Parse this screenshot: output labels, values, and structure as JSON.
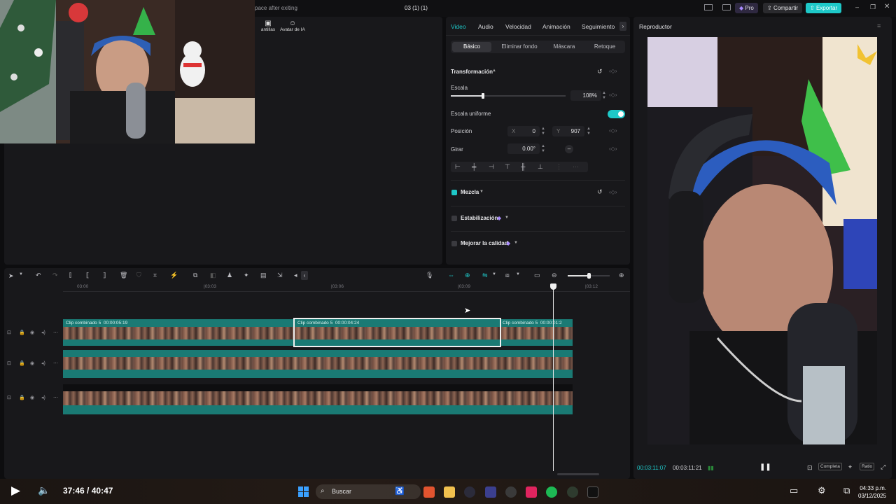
{
  "window": {
    "title_hint": "pace after exiting",
    "project_title": "03 (1) (1)",
    "pro_label": "Pro",
    "share_label": "Compartir",
    "export_label": "Exportar"
  },
  "left_panel": {
    "tools": [
      {
        "label": "antillas",
        "icon": "template-icon"
      },
      {
        "label": "Avatar de IA",
        "icon": "avatar-icon"
      }
    ]
  },
  "properties": {
    "tabs": [
      "Video",
      "Audio",
      "Velocidad",
      "Animación",
      "Seguimiento"
    ],
    "active_tab": "Video",
    "subtabs": [
      "Básico",
      "Eliminar fondo",
      "Máscara",
      "Retoque"
    ],
    "active_subtab": "Básico",
    "transform_title": "Transformación",
    "scale_label": "Escala",
    "scale_value": "108%",
    "scale_fraction": 0.28,
    "uniform_scale_label": "Escala uniforme",
    "uniform_scale_on": true,
    "position_label": "Posición",
    "pos_x_label": "X",
    "pos_x": "0",
    "pos_y_label": "Y",
    "pos_y": "907",
    "rotate_label": "Girar",
    "rotate_value": "0.00°",
    "blend_label": "Mezcla",
    "stabilization_label": "Estabilización",
    "enhance_label": "Mejorar la calidad"
  },
  "player": {
    "title": "Reproductor",
    "current_time": "00:03:11:07",
    "total_time": "00:03:11:21",
    "full_label": "Completa",
    "ratio_label": "Ratio"
  },
  "timeline": {
    "ruler": [
      "03:00",
      "|03:03",
      "|03:06",
      "|03:09",
      "|03:12"
    ],
    "clips_track1": [
      {
        "name": "Clip combinado 5",
        "duration": "00:00:05:19"
      },
      {
        "name": "Clip combinado 5",
        "duration": "00:00:04:24"
      },
      {
        "name": "Clip combinado 5",
        "duration": "00:00:01:2"
      }
    ]
  },
  "video_player": {
    "elapsed": "37:46",
    "separator": "/",
    "duration": "40:47"
  },
  "taskbar": {
    "search_placeholder": "Buscar",
    "time": "04:33 p.m.",
    "date": "03/12/2025"
  },
  "colors": {
    "accent": "#1ec8c8",
    "clip_teal": "#1a7a74"
  }
}
